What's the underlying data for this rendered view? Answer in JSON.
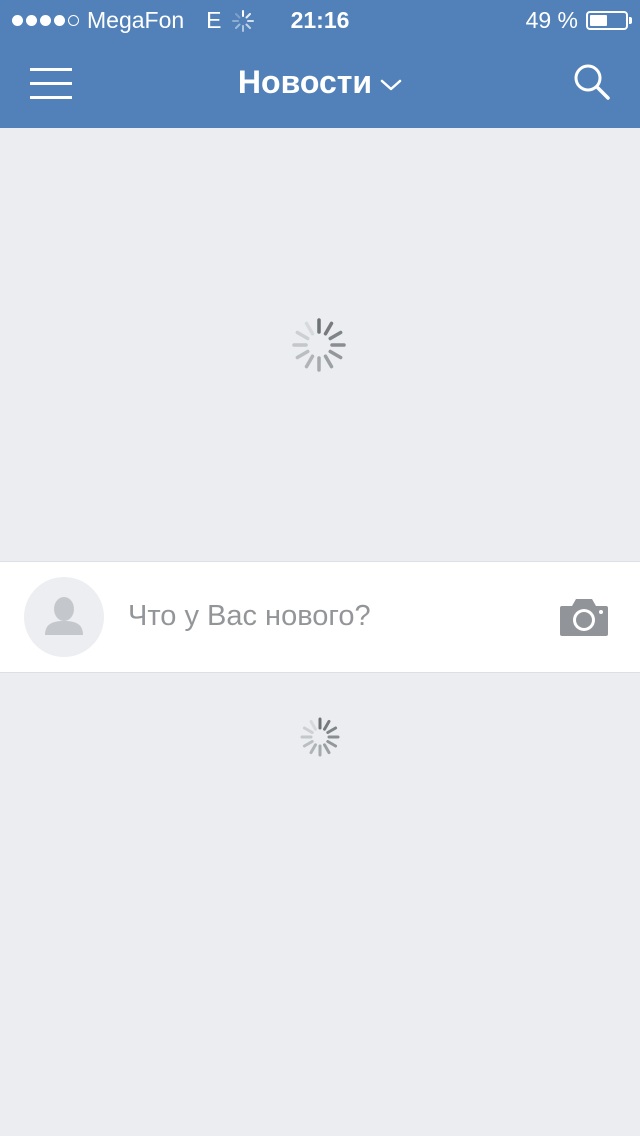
{
  "status_bar": {
    "signal_dots_filled": 4,
    "signal_dots_total": 5,
    "carrier": "MegaFon",
    "network": "E",
    "time": "21:16",
    "battery_percent_label": "49 %",
    "battery_level": 0.49
  },
  "header": {
    "title": "Новости",
    "menu_icon": "hamburger-menu-icon",
    "dropdown_icon": "chevron-down-icon",
    "search_icon": "search-icon",
    "background_color": "#5181b8"
  },
  "composer": {
    "placeholder": "Что у Вас нового?",
    "avatar_icon": "user-placeholder-icon",
    "camera_icon": "camera-icon"
  },
  "colors": {
    "page_background": "#ebedf0",
    "spinner": "#6d7277"
  }
}
